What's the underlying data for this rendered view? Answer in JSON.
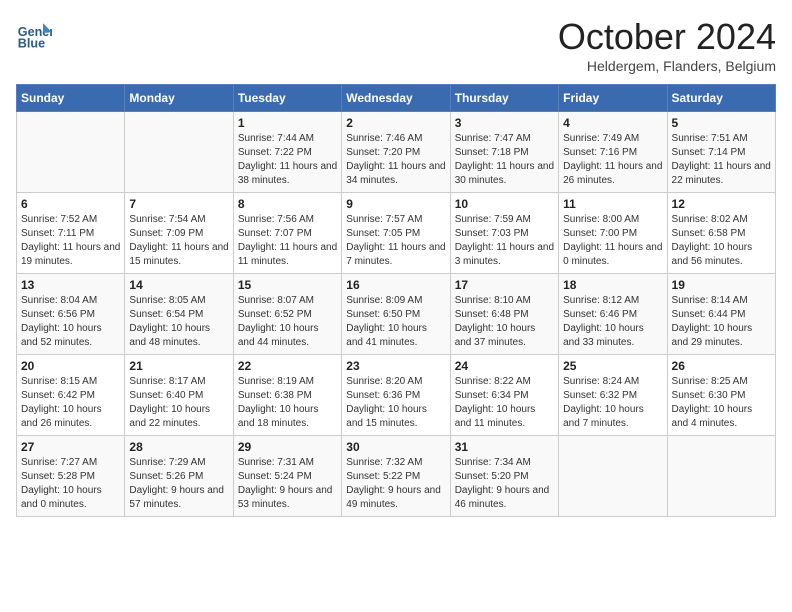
{
  "header": {
    "logo_line1": "General",
    "logo_line2": "Blue",
    "month": "October 2024",
    "location": "Heldergem, Flanders, Belgium"
  },
  "weekdays": [
    "Sunday",
    "Monday",
    "Tuesday",
    "Wednesday",
    "Thursday",
    "Friday",
    "Saturday"
  ],
  "weeks": [
    [
      {
        "day": "",
        "info": ""
      },
      {
        "day": "",
        "info": ""
      },
      {
        "day": "1",
        "info": "Sunrise: 7:44 AM\nSunset: 7:22 PM\nDaylight: 11 hours and 38 minutes."
      },
      {
        "day": "2",
        "info": "Sunrise: 7:46 AM\nSunset: 7:20 PM\nDaylight: 11 hours and 34 minutes."
      },
      {
        "day": "3",
        "info": "Sunrise: 7:47 AM\nSunset: 7:18 PM\nDaylight: 11 hours and 30 minutes."
      },
      {
        "day": "4",
        "info": "Sunrise: 7:49 AM\nSunset: 7:16 PM\nDaylight: 11 hours and 26 minutes."
      },
      {
        "day": "5",
        "info": "Sunrise: 7:51 AM\nSunset: 7:14 PM\nDaylight: 11 hours and 22 minutes."
      }
    ],
    [
      {
        "day": "6",
        "info": "Sunrise: 7:52 AM\nSunset: 7:11 PM\nDaylight: 11 hours and 19 minutes."
      },
      {
        "day": "7",
        "info": "Sunrise: 7:54 AM\nSunset: 7:09 PM\nDaylight: 11 hours and 15 minutes."
      },
      {
        "day": "8",
        "info": "Sunrise: 7:56 AM\nSunset: 7:07 PM\nDaylight: 11 hours and 11 minutes."
      },
      {
        "day": "9",
        "info": "Sunrise: 7:57 AM\nSunset: 7:05 PM\nDaylight: 11 hours and 7 minutes."
      },
      {
        "day": "10",
        "info": "Sunrise: 7:59 AM\nSunset: 7:03 PM\nDaylight: 11 hours and 3 minutes."
      },
      {
        "day": "11",
        "info": "Sunrise: 8:00 AM\nSunset: 7:00 PM\nDaylight: 11 hours and 0 minutes."
      },
      {
        "day": "12",
        "info": "Sunrise: 8:02 AM\nSunset: 6:58 PM\nDaylight: 10 hours and 56 minutes."
      }
    ],
    [
      {
        "day": "13",
        "info": "Sunrise: 8:04 AM\nSunset: 6:56 PM\nDaylight: 10 hours and 52 minutes."
      },
      {
        "day": "14",
        "info": "Sunrise: 8:05 AM\nSunset: 6:54 PM\nDaylight: 10 hours and 48 minutes."
      },
      {
        "day": "15",
        "info": "Sunrise: 8:07 AM\nSunset: 6:52 PM\nDaylight: 10 hours and 44 minutes."
      },
      {
        "day": "16",
        "info": "Sunrise: 8:09 AM\nSunset: 6:50 PM\nDaylight: 10 hours and 41 minutes."
      },
      {
        "day": "17",
        "info": "Sunrise: 8:10 AM\nSunset: 6:48 PM\nDaylight: 10 hours and 37 minutes."
      },
      {
        "day": "18",
        "info": "Sunrise: 8:12 AM\nSunset: 6:46 PM\nDaylight: 10 hours and 33 minutes."
      },
      {
        "day": "19",
        "info": "Sunrise: 8:14 AM\nSunset: 6:44 PM\nDaylight: 10 hours and 29 minutes."
      }
    ],
    [
      {
        "day": "20",
        "info": "Sunrise: 8:15 AM\nSunset: 6:42 PM\nDaylight: 10 hours and 26 minutes."
      },
      {
        "day": "21",
        "info": "Sunrise: 8:17 AM\nSunset: 6:40 PM\nDaylight: 10 hours and 22 minutes."
      },
      {
        "day": "22",
        "info": "Sunrise: 8:19 AM\nSunset: 6:38 PM\nDaylight: 10 hours and 18 minutes."
      },
      {
        "day": "23",
        "info": "Sunrise: 8:20 AM\nSunset: 6:36 PM\nDaylight: 10 hours and 15 minutes."
      },
      {
        "day": "24",
        "info": "Sunrise: 8:22 AM\nSunset: 6:34 PM\nDaylight: 10 hours and 11 minutes."
      },
      {
        "day": "25",
        "info": "Sunrise: 8:24 AM\nSunset: 6:32 PM\nDaylight: 10 hours and 7 minutes."
      },
      {
        "day": "26",
        "info": "Sunrise: 8:25 AM\nSunset: 6:30 PM\nDaylight: 10 hours and 4 minutes."
      }
    ],
    [
      {
        "day": "27",
        "info": "Sunrise: 7:27 AM\nSunset: 5:28 PM\nDaylight: 10 hours and 0 minutes."
      },
      {
        "day": "28",
        "info": "Sunrise: 7:29 AM\nSunset: 5:26 PM\nDaylight: 9 hours and 57 minutes."
      },
      {
        "day": "29",
        "info": "Sunrise: 7:31 AM\nSunset: 5:24 PM\nDaylight: 9 hours and 53 minutes."
      },
      {
        "day": "30",
        "info": "Sunrise: 7:32 AM\nSunset: 5:22 PM\nDaylight: 9 hours and 49 minutes."
      },
      {
        "day": "31",
        "info": "Sunrise: 7:34 AM\nSunset: 5:20 PM\nDaylight: 9 hours and 46 minutes."
      },
      {
        "day": "",
        "info": ""
      },
      {
        "day": "",
        "info": ""
      }
    ]
  ]
}
